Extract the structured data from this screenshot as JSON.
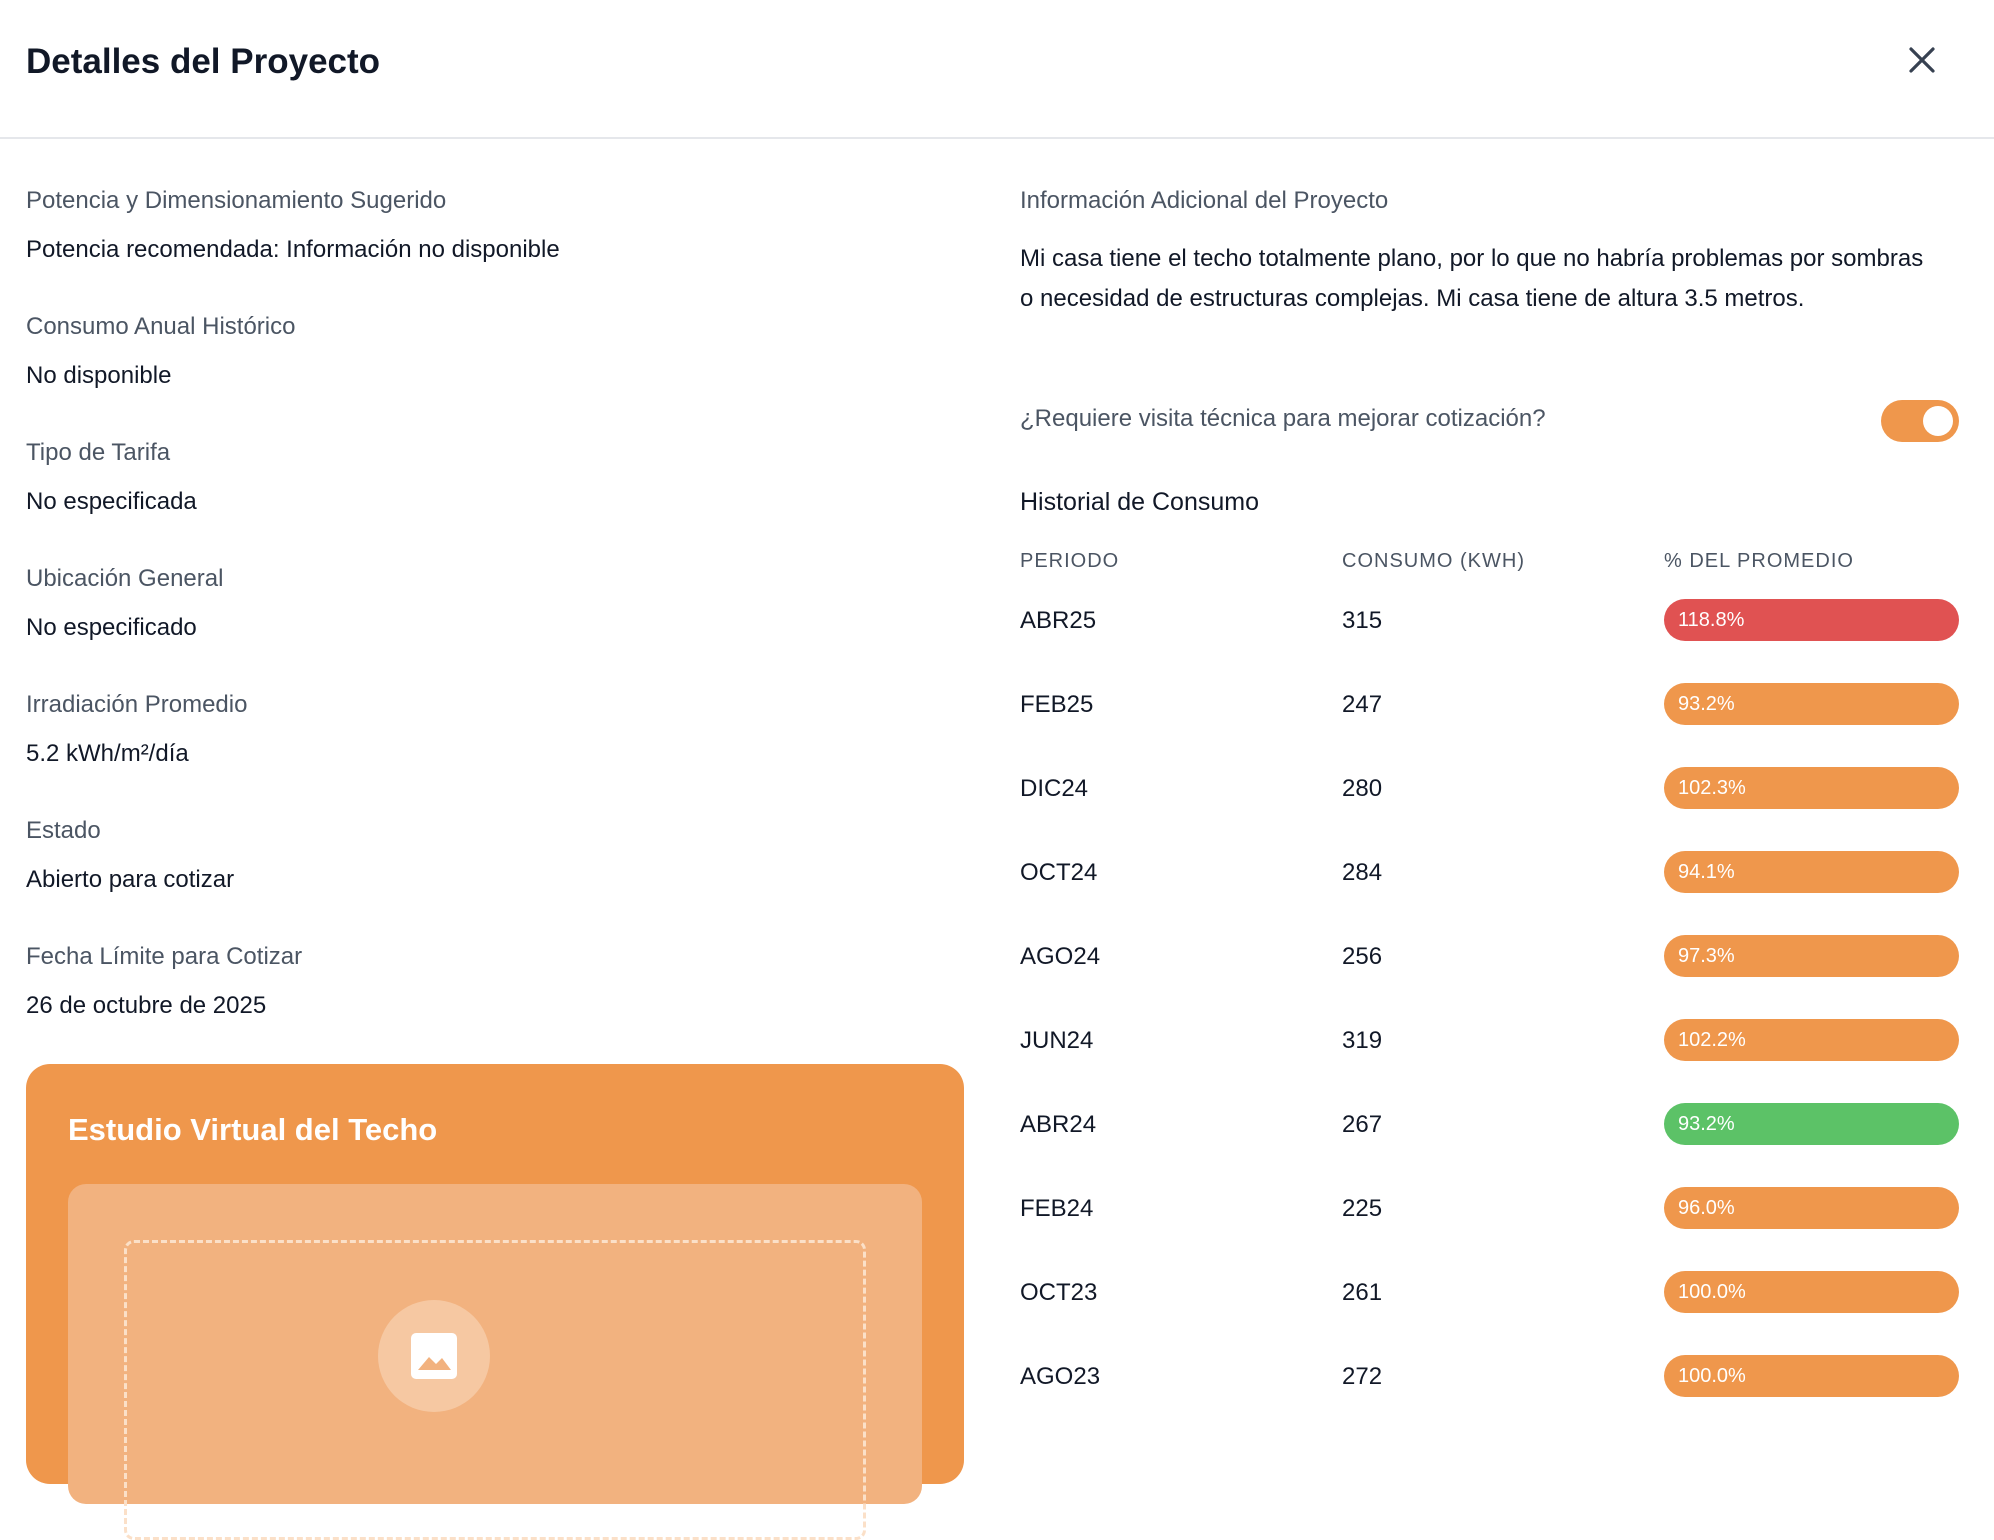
{
  "header": {
    "title": "Detalles del Proyecto"
  },
  "fields": [
    {
      "label": "Potencia y Dimensionamiento Sugerido",
      "value": "Potencia recomendada: Información no disponible"
    },
    {
      "label": "Consumo Anual Histórico",
      "value": "No disponible"
    },
    {
      "label": "Tipo de Tarifa",
      "value": "No especificada"
    },
    {
      "label": "Ubicación General",
      "value": "No especificado"
    },
    {
      "label": "Irradiación Promedio",
      "value": "5.2 kWh/m²/día"
    },
    {
      "label": "Estado",
      "value": "Abierto para cotizar"
    },
    {
      "label": "Fecha Límite para Cotizar",
      "value": "26 de octubre de 2025"
    }
  ],
  "roof": {
    "title": "Estudio Virtual del Techo",
    "icon": "image-icon"
  },
  "info": {
    "label": "Información Adicional del Proyecto",
    "text": "Mi casa tiene el techo totalmente plano, por lo que no habría problemas por sombras o necesidad de estructuras complejas. Mi casa tiene de altura 3.5 metros."
  },
  "visit": {
    "label": "¿Requiere visita técnica para mejorar cotización?",
    "enabled": true
  },
  "history": {
    "title": "Historial de Consumo",
    "columns": [
      "PERIODO",
      "CONSUMO (KWH)",
      "% DEL PROMEDIO"
    ],
    "rows": [
      {
        "period": "ABR25",
        "consumption": "315",
        "percent": "118.8%",
        "color": "#e05252"
      },
      {
        "period": "FEB25",
        "consumption": "247",
        "percent": "93.2%",
        "color": "#ef974c"
      },
      {
        "period": "DIC24",
        "consumption": "280",
        "percent": "102.3%",
        "color": "#ef974c"
      },
      {
        "period": "OCT24",
        "consumption": "284",
        "percent": "94.1%",
        "color": "#ef974c"
      },
      {
        "period": "AGO24",
        "consumption": "256",
        "percent": "97.3%",
        "color": "#ef974c"
      },
      {
        "period": "JUN24",
        "consumption": "319",
        "percent": "102.2%",
        "color": "#ef974c"
      },
      {
        "period": "ABR24",
        "consumption": "267",
        "percent": "93.2%",
        "color": "#5cc267"
      },
      {
        "period": "FEB24",
        "consumption": "225",
        "percent": "96.0%",
        "color": "#ef974c"
      },
      {
        "period": "OCT23",
        "consumption": "261",
        "percent": "100.0%",
        "color": "#ef974c"
      },
      {
        "period": "AGO23",
        "consumption": "272",
        "percent": "100.0%",
        "color": "#ef974c"
      }
    ]
  },
  "colors": {
    "accent": "#ef974c",
    "high": "#e05252",
    "low": "#5cc267"
  }
}
